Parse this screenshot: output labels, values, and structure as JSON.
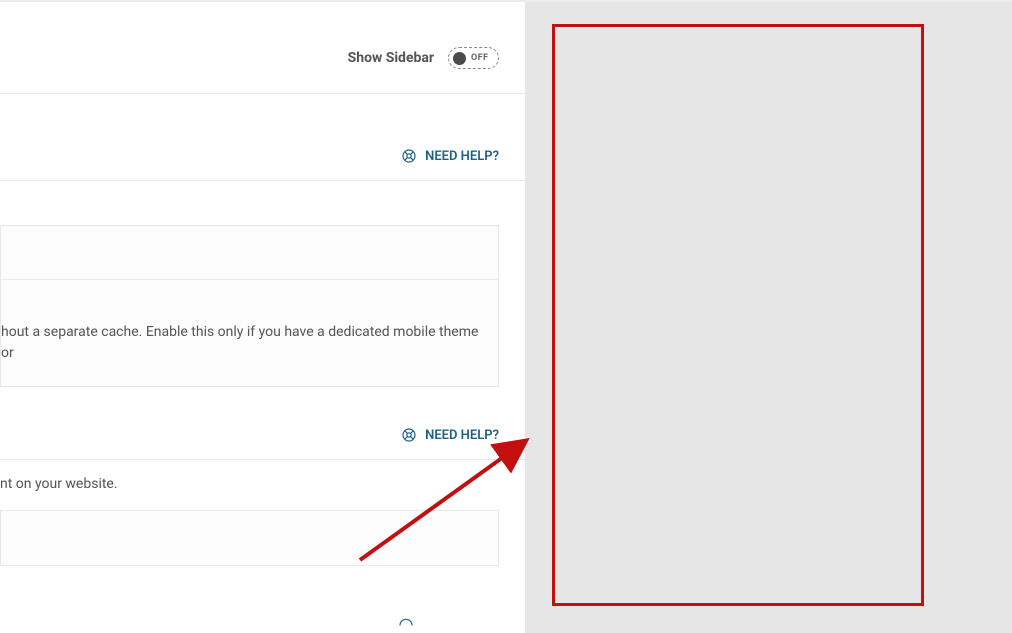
{
  "top": {
    "show_sidebar_label": "Show Sidebar",
    "toggle_state": "OFF"
  },
  "help_link": "NEED HELP?",
  "card": {
    "description_fragment": "hout a separate cache. Enable this only if you have a dedicated mobile theme or"
  },
  "line_text": "nt on your website.",
  "colors": {
    "link": "#1e6187",
    "annotation": "#c20f0f"
  }
}
